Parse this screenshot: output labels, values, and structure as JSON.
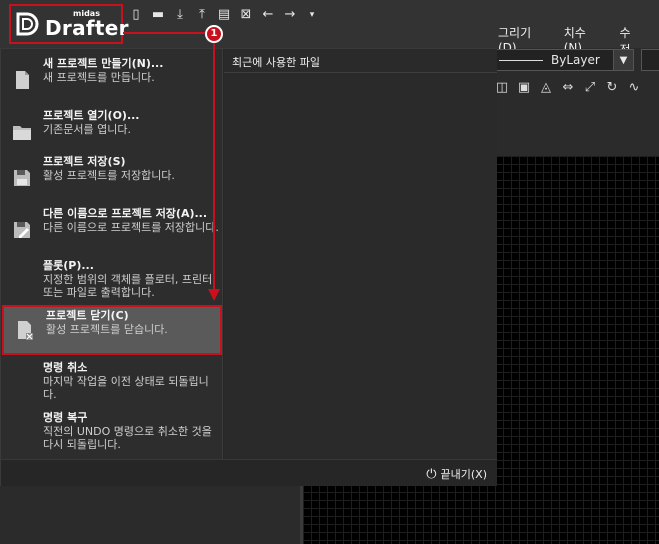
{
  "logo": {
    "small": "midas",
    "big": "Drafter"
  },
  "quick_access": [
    "new-icon",
    "open-folder-icon",
    "save-icon",
    "import-icon",
    "export-icon",
    "print-icon",
    "close-doc-icon",
    "undo-icon",
    "redo-icon",
    "more-icon"
  ],
  "menubar": {
    "draw": "그리기(D)",
    "dimension": "치수(N)",
    "modify": "수정"
  },
  "properties": {
    "linetype": "ByLayer"
  },
  "file_menu": {
    "recent_title": "최근에 사용한 파일",
    "items": [
      {
        "title": "새 프로젝트 만들기(N)...",
        "desc": "새 프로젝트를 만듭니다.",
        "icon": "new-project-icon"
      },
      {
        "title": "프로젝트 열기(O)...",
        "desc": "기존문서를 엽니다.",
        "icon": "open-folder-icon"
      },
      {
        "title": "프로젝트 저장(S)",
        "desc": "활성 프로젝트를 저장합니다.",
        "icon": "save-icon"
      },
      {
        "title": "다른 이름으로 프로젝트 저장(A)...",
        "desc": "다른 이름으로 프로젝트를 저장합니다.",
        "icon": "save-as-icon"
      },
      {
        "title": "플롯(P)...",
        "desc": "지정한 범위의 객체를 플로터, 프린터 또는 파일로 출력합니다.",
        "icon": "plot-icon"
      },
      {
        "title": "프로젝트 닫기(C)",
        "desc": "활성 프로젝트를 닫습니다.",
        "icon": "close-project-icon"
      },
      {
        "title": "명령 취소",
        "desc": "마지막 작업을 이전 상태로 되돌립니다.",
        "icon": ""
      },
      {
        "title": "명령 복구",
        "desc": "직전의 UNDO 명령으로 취소한 것을 다시 되돌립니다.",
        "icon": ""
      }
    ],
    "exit_label": "끝내기(X)"
  },
  "annotation": {
    "step": "1"
  },
  "colors": {
    "accent": "#c8101e",
    "panel": "#2d2d2d",
    "selected": "#5a5a5a"
  }
}
